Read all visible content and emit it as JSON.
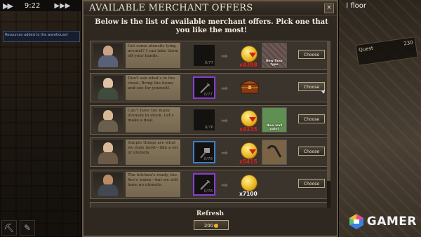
{
  "game": {
    "time": "9:22",
    "floor_label": "l floor",
    "notice_text": "Resources added to the warehouse!",
    "hud_right_left": "Quest",
    "hud_right_right": "230"
  },
  "dialog": {
    "title": "AVAILABLE MERCHANT OFFERS",
    "subtitle": "Below is the list of available merchant offers. Pick one that you like the most!",
    "close_glyph": "×"
  },
  "offers": [
    {
      "text": "Got some utensils lying around? I can take them off your hands.",
      "slot_count": "0/77",
      "slot_rarity": "none",
      "coin_value": "x4388",
      "coin_color": "#e0201c",
      "reward_label": "New floor type",
      "reward_type": "floor",
      "choose_label": "Choose"
    },
    {
      "text": "Don't ask what's in the chest. Bring the items and see for yourself.",
      "slot_count": "0/77",
      "slot_rarity": "purple",
      "coin_value": "",
      "coin_color": "#e0201c",
      "reward_label": "",
      "reward_type": "chest",
      "choose_label": "Choose"
    },
    {
      "text": "Can't have too many utensils in stock. Let's make a deal.",
      "slot_count": "0/76",
      "slot_rarity": "none",
      "coin_value": "x4335",
      "coin_color": "#e0201c",
      "reward_label": "New wall paint",
      "reward_type": "paint",
      "choose_label": "Choose"
    },
    {
      "text": "Simple things are what we miss most—like a set of utensils.",
      "slot_count": "0/76",
      "slot_rarity": "blue",
      "coin_value": "x5415",
      "coin_color": "#e0201c",
      "reward_label": "",
      "reward_type": "tool",
      "choose_label": "Choose"
    },
    {
      "text": "The kitchen's ready, the fire's warm—but we still have no utensils.",
      "slot_count": "0/78",
      "slot_rarity": "purple",
      "coin_value": "x7100",
      "coin_color": "#f2f2f2",
      "reward_label": "",
      "reward_type": "none",
      "choose_label": "Choose"
    }
  ],
  "refresh": {
    "label": "Refresh",
    "cost": "200"
  },
  "watermark": {
    "text": "GAMER"
  },
  "icons": [
    "close-icon",
    "play-icon",
    "fast-forward-icon",
    "coin-icon",
    "arrow-right-icon",
    "chest-icon",
    "utensil-icon",
    "pickaxe-icon"
  ]
}
